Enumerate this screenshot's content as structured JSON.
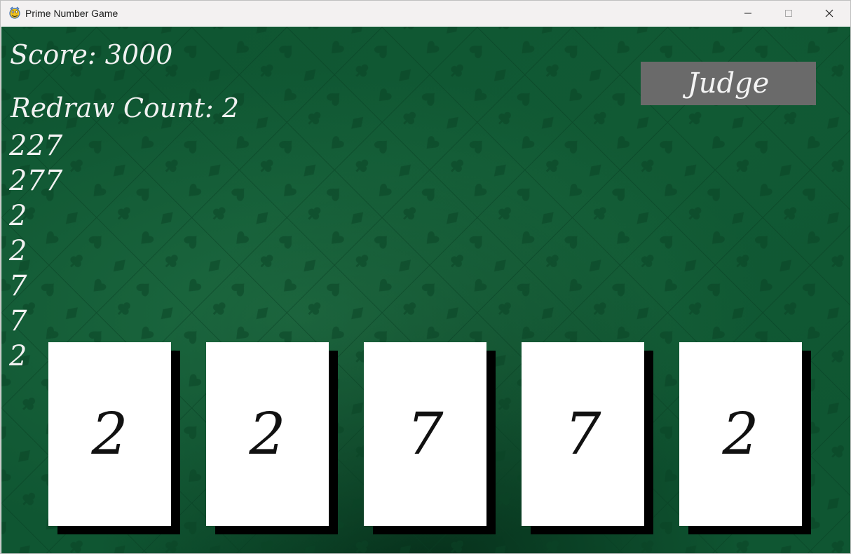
{
  "window": {
    "title": "Prime Number Game",
    "icons": {
      "app": "pygame-snake-icon",
      "minimize": "minimize-icon",
      "maximize": "maximize-icon",
      "close": "close-icon"
    }
  },
  "colors": {
    "felt": "#0f5632",
    "button": "#6a6a6a",
    "text": "#f1f1f1",
    "card": "#ffffff",
    "card_shadow": "#000000"
  },
  "hud": {
    "score": "Score: 3000",
    "redraw": "Redraw Count: 2"
  },
  "history": [
    "227",
    "277",
    "2",
    "2",
    "7",
    "7",
    "2"
  ],
  "judge_button": "Judge",
  "cards": [
    "2",
    "2",
    "7",
    "7",
    "2"
  ]
}
